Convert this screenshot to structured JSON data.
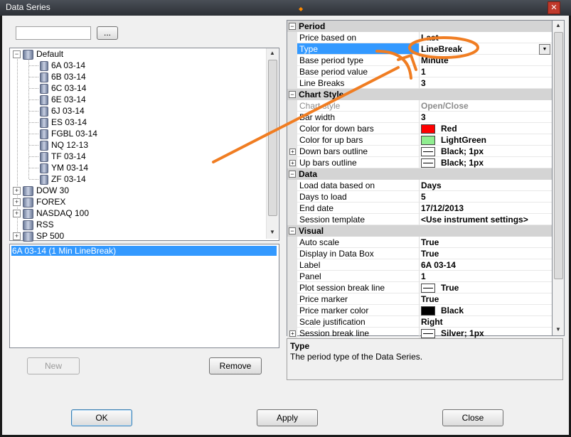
{
  "window": {
    "title": "Data Series",
    "close_glyph": "✕"
  },
  "search": {
    "placeholder": "",
    "browse_label": "..."
  },
  "tree": {
    "root": {
      "label": "Default",
      "expanded": true,
      "children": [
        "6A 03-14",
        "6B 03-14",
        "6C 03-14",
        "6E 03-14",
        "6J 03-14",
        "ES 03-14",
        "FGBL 03-14",
        "NQ 12-13",
        "TF 03-14",
        "YM 03-14",
        "ZF 03-14"
      ]
    },
    "collapsed": [
      "DOW 30",
      "FOREX",
      "NASDAQ 100",
      "RSS",
      "SP 500"
    ]
  },
  "series_list": {
    "items": [
      "6A 03-14 (1 Min LineBreak)"
    ]
  },
  "left_buttons": {
    "new_label": "New",
    "remove_label": "Remove"
  },
  "properties": {
    "period": {
      "category": "Period",
      "rows": [
        {
          "name": "Price based on",
          "value": "Last"
        },
        {
          "name": "Type",
          "value": "LineBreak"
        },
        {
          "name": "Base period type",
          "value": "Minute"
        },
        {
          "name": "Base period value",
          "value": "1"
        },
        {
          "name": "Line Breaks",
          "value": "3"
        }
      ]
    },
    "chart_style": {
      "category": "Chart Style",
      "rows": [
        {
          "name": "Chart style",
          "value": "Open/Close"
        },
        {
          "name": "Bar width",
          "value": "3"
        },
        {
          "name": "Color for down bars",
          "value": "Red",
          "color": "#ff0000"
        },
        {
          "name": "Color for up bars",
          "value": "LightGreen",
          "color": "#90ee90"
        },
        {
          "name": "Down bars outline",
          "value": "Black; 1px"
        },
        {
          "name": "Up bars outline",
          "value": "Black; 1px"
        }
      ]
    },
    "data": {
      "category": "Data",
      "rows": [
        {
          "name": "Load data based on",
          "value": "Days"
        },
        {
          "name": "Days to load",
          "value": "5"
        },
        {
          "name": "End date",
          "value": "17/12/2013"
        },
        {
          "name": "Session template",
          "value": "<Use instrument settings>"
        }
      ]
    },
    "visual": {
      "category": "Visual",
      "rows": [
        {
          "name": "Auto scale",
          "value": "True"
        },
        {
          "name": "Display in Data Box",
          "value": "True"
        },
        {
          "name": "Label",
          "value": "6A 03-14"
        },
        {
          "name": "Panel",
          "value": "1"
        },
        {
          "name": "Plot session break line",
          "value": "True"
        },
        {
          "name": "Price marker",
          "value": "True"
        },
        {
          "name": "Price marker color",
          "value": "Black",
          "color": "#000000"
        },
        {
          "name": "Scale justification",
          "value": "Right"
        },
        {
          "name": "Session break line",
          "value": "Silver; 1px"
        }
      ]
    }
  },
  "description": {
    "title": "Type",
    "text": "The period type of the Data Series."
  },
  "footer": {
    "ok_label": "OK",
    "apply_label": "Apply",
    "close_label": "Close"
  },
  "colors": {
    "selection": "#3399ff",
    "annotation": "#f07d22",
    "title_bar": "#2c3036"
  }
}
